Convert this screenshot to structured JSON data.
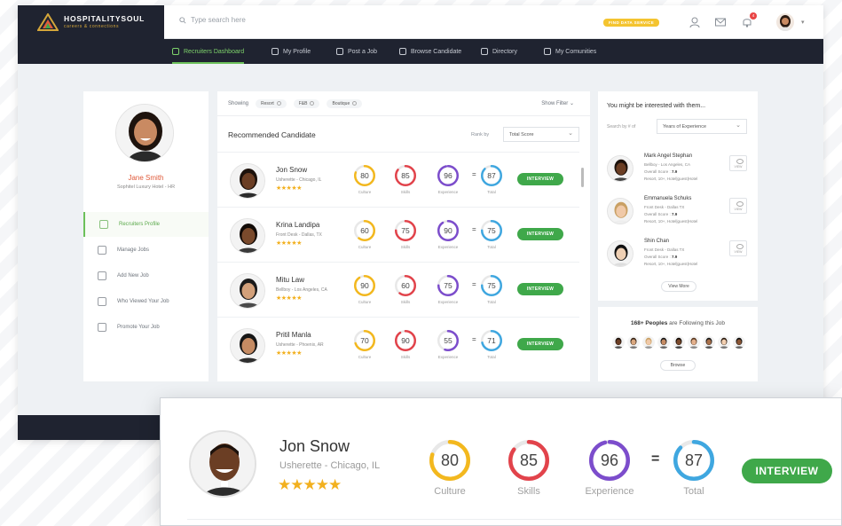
{
  "brand": {
    "name": "HOSPITALITYSOUL",
    "tagline": "careers & connections"
  },
  "search": {
    "placeholder": "Type search here"
  },
  "topbar": {
    "badge": "FIND DATA SERVICE",
    "notification_count": "4"
  },
  "nav": [
    {
      "label": "Recruiters Dashboard",
      "active": true
    },
    {
      "label": "My Profile"
    },
    {
      "label": "Post a Job"
    },
    {
      "label": "Browse Candidate"
    },
    {
      "label": "Directory"
    },
    {
      "label": "My Comunities"
    }
  ],
  "profile": {
    "name": "Jane Smith",
    "subtitle": "Sophitel Luxury Hotel - HR",
    "menu": [
      {
        "label": "Recruiters Profile",
        "active": true,
        "icon": "user-icon"
      },
      {
        "label": "Manage Jobs",
        "icon": "gears-icon"
      },
      {
        "label": "Add New Job",
        "icon": "add-job-icon"
      },
      {
        "label": "Who Viewed Your Job",
        "icon": "eye-icon"
      },
      {
        "label": "Promote Your Job",
        "icon": "flag-icon"
      }
    ]
  },
  "filters": {
    "showing_label": "Showing",
    "chips": [
      "Resort",
      "F&B",
      "Boutique"
    ],
    "show_filter": "Show Filter"
  },
  "recommended": {
    "title": "Recommended Candidate",
    "rank_label": "Rank by",
    "rank_value": "Total Score",
    "metric_labels": [
      "Culture",
      "Skills",
      "Experience",
      "Total"
    ],
    "interview_label": "INTERVIEW",
    "candidates": [
      {
        "name": "Jon Snow",
        "meta": "Usherette - Chicago, IL",
        "stars": "★★★★★",
        "scores": [
          80,
          85,
          96,
          87
        ]
      },
      {
        "name": "Krina Landipa",
        "meta": "Front Desk - Dallas, TX",
        "stars": "★★★★★",
        "scores": [
          60,
          75,
          90,
          75
        ]
      },
      {
        "name": "Mitu Law",
        "meta": "Bellboy - Los Angeles, CA",
        "stars": "★★★★★",
        "scores": [
          90,
          60,
          75,
          75
        ]
      },
      {
        "name": "Pritil Manla",
        "meta": "Usherette - Phoenix, AR",
        "stars": "★★★★★",
        "scores": [
          70,
          90,
          55,
          71
        ]
      }
    ]
  },
  "suggestions": {
    "title": "You might be interested with them...",
    "search_label": "Search by # of",
    "select_value": "Years of Experience",
    "score_label": "Overall Score :",
    "view_label": "VIEW",
    "people": [
      {
        "name": "Mark Angel Stephan",
        "role": "Bellboy - Los Angeles, CA",
        "score": "7.9",
        "tags": "Resort, 10+, Hotel|guest|Hotel"
      },
      {
        "name": "Emmanuela Schuks",
        "role": "Front Desk - Dallas TX",
        "score": "7.9",
        "tags": "Resort, 10+, Hotel|guest|Hotel"
      },
      {
        "name": "Shin Chan",
        "role": "Front Desk - Dallas TX",
        "score": "7.9",
        "tags": "Resort, 10+, Hotel|guest|Hotel"
      }
    ],
    "view_more": "View More"
  },
  "following": {
    "count_text": "168+ Peoples",
    "suffix": " are Following this Job",
    "browse": "Browse"
  },
  "zoom": {
    "name": "Jon Snow",
    "meta": "Usherette - Chicago, IL",
    "stars": "★★★★★",
    "scores": [
      80,
      85,
      96,
      87
    ],
    "labels": [
      "Culture",
      "Skills",
      "Experience",
      "Total"
    ],
    "button": "INTERVIEW"
  },
  "colors": {
    "dark": "#1f2330",
    "accent_green": "#3fa84a",
    "culture": "#f3b81e",
    "skills": "#e2434b",
    "experience": "#7c4dcc",
    "total": "#3fa7e0"
  }
}
